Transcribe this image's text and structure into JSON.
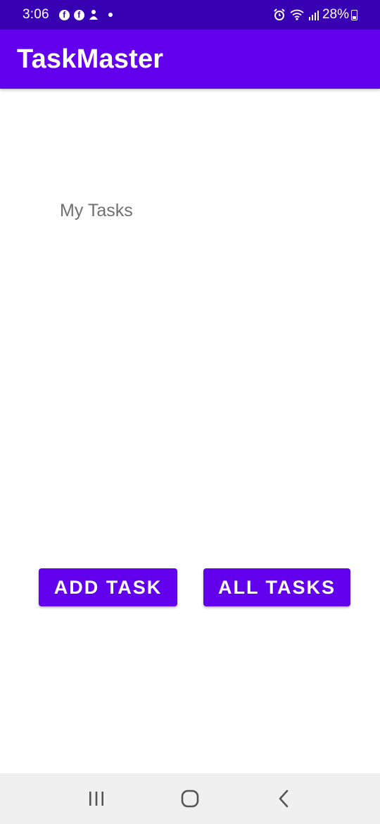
{
  "status_bar": {
    "time": "3:06",
    "battery": "28%",
    "icons": [
      "facebook-icon",
      "facebook-icon",
      "notification-icon",
      "dot-icon",
      "alarm-icon",
      "wifi-icon",
      "signal-icon",
      "battery-icon"
    ]
  },
  "app_bar": {
    "title": "TaskMaster",
    "color": "#6200ee"
  },
  "main": {
    "heading": "My Tasks",
    "add_task_label": "ADD TASK",
    "all_tasks_label": "ALL TASKS"
  },
  "nav_bar": {
    "buttons": [
      "recents-icon",
      "home-icon",
      "back-icon"
    ]
  },
  "colors": {
    "status_bar": "#3700b3",
    "primary": "#6200ee",
    "text_secondary": "#6f6f6f",
    "nav_bar": "#f0f0f0"
  }
}
